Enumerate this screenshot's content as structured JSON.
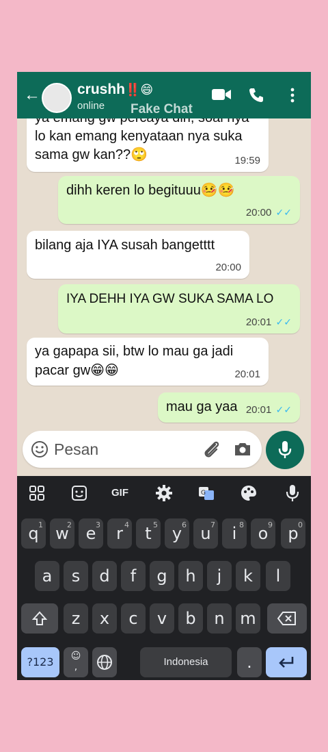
{
  "header": {
    "contact_name": "crushh",
    "contact_emoji": "‼️😄",
    "status": "online",
    "watermark": "Fake Chat"
  },
  "messages": [
    {
      "direction": "in",
      "text_line1": "ya emang gw percaya diri, soal nya",
      "text_line2": "lo kan emang kenyataan nya suka",
      "text_line3": "sama gw kan??🙄",
      "time": "19:59"
    },
    {
      "direction": "out",
      "text": "dihh keren lo begituuu🤒🤒",
      "time": "20:00"
    },
    {
      "direction": "in",
      "text": "bilang aja IYA susah bangetttt",
      "time": "20:00"
    },
    {
      "direction": "out",
      "text": "IYA DEHH IYA GW SUKA SAMA LO",
      "time": "20:01"
    },
    {
      "direction": "in",
      "text_line1": "ya gapapa sii, btw lo mau ga jadi",
      "text_line2": "pacar gw😁😁",
      "time": "20:01"
    },
    {
      "direction": "out",
      "text": "mau ga yaa",
      "time": "20:01"
    }
  ],
  "ticks": "✓✓",
  "input": {
    "placeholder": "Pesan"
  },
  "keyboard": {
    "row1": [
      "q",
      "w",
      "e",
      "r",
      "t",
      "y",
      "u",
      "i",
      "o",
      "p"
    ],
    "row1_hints": [
      "1",
      "2",
      "3",
      "4",
      "5",
      "6",
      "7",
      "8",
      "9",
      "0"
    ],
    "row2": [
      "a",
      "s",
      "d",
      "f",
      "g",
      "h",
      "j",
      "k",
      "l"
    ],
    "row3": [
      "z",
      "x",
      "c",
      "v",
      "b",
      "n",
      "m"
    ],
    "symbols_label": "?123",
    "emoji_comma": ",",
    "space_label": "Indonesia",
    "period": ".",
    "gif_label": "GIF"
  },
  "colors": {
    "header": "#0d6b58",
    "outgoing_bubble": "#dcf8c6",
    "incoming_bubble": "#ffffff",
    "page_background": "#f4b8c8",
    "keyboard_background": "#202124"
  }
}
